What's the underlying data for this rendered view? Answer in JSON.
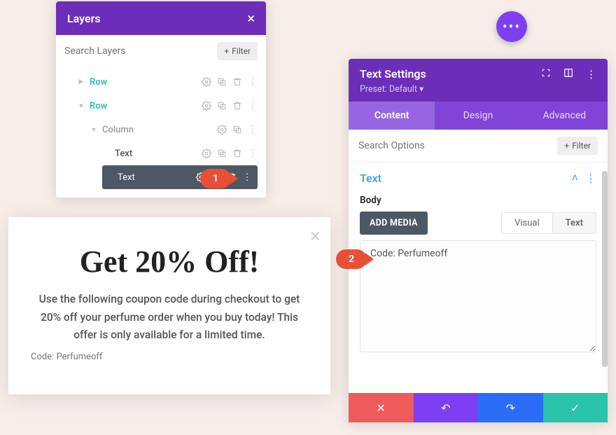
{
  "float_dots_label": "•••",
  "layers": {
    "title": "Layers",
    "close_label": "×",
    "search_placeholder": "Search Layers",
    "filter_label": "Filter",
    "rows": [
      {
        "label": "Row"
      },
      {
        "label": "Row"
      },
      {
        "label": "Column"
      },
      {
        "label": "Text"
      },
      {
        "label": "Text"
      }
    ]
  },
  "callouts": {
    "one": "1",
    "two": "2"
  },
  "popup": {
    "close_label": "×",
    "heading": "Get 20% Off!",
    "body": "Use the following coupon code during checkout to get 20% off your perfume order when you buy today! This offer is only available for a limited time.",
    "code_line": "Code: Perfumeoff"
  },
  "settings": {
    "title": "Text Settings",
    "preset_label": "Preset: Default",
    "tabs": {
      "content": "Content",
      "design": "Design",
      "advanced": "Advanced"
    },
    "search_placeholder": "Search Options",
    "filter_label": "Filter",
    "section_title": "Text",
    "body_label": "Body",
    "add_media_label": "ADD MEDIA",
    "editor_tabs": {
      "visual": "Visual",
      "text": "Text"
    },
    "editor_value": "Code: Perfumeoff",
    "footer": {
      "cancel": "✕",
      "undo": "↶",
      "redo": "↷",
      "save": "✓"
    }
  }
}
